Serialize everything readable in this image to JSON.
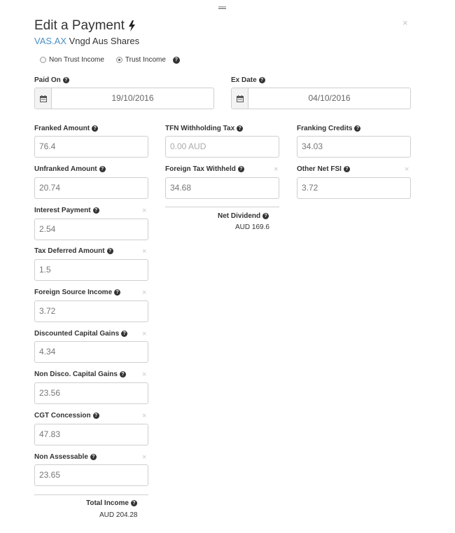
{
  "header": {
    "title": "Edit a Payment",
    "ticker": "VAS.AX",
    "security_name": "Vngd Aus Shares",
    "close": "×"
  },
  "income_type": {
    "options": [
      "Non Trust Income",
      "Trust Income"
    ],
    "selected": "Trust Income"
  },
  "dates": {
    "paid_on_label": "Paid On",
    "paid_on": "19/10/2016",
    "ex_date_label": "Ex Date",
    "ex_date": "04/10/2016"
  },
  "fields": {
    "franked_amount": {
      "label": "Franked Amount",
      "value": "76.4"
    },
    "tfn_withholding": {
      "label": "TFN Withholding Tax",
      "placeholder": "0.00 AUD"
    },
    "franking_credits": {
      "label": "Franking Credits",
      "value": "34.03"
    },
    "unfranked_amount": {
      "label": "Unfranked Amount",
      "value": "20.74"
    },
    "foreign_tax_withheld": {
      "label": "Foreign Tax Withheld",
      "value": "34.68"
    },
    "other_net_fsi": {
      "label": "Other Net FSI",
      "value": "3.72"
    },
    "interest_payment": {
      "label": "Interest Payment",
      "value": "2.54"
    },
    "tax_deferred": {
      "label": "Tax Deferred Amount",
      "value": "1.5"
    },
    "foreign_source_income": {
      "label": "Foreign Source Income",
      "value": "3.72"
    },
    "discounted_capital_gains": {
      "label": "Discounted Capital Gains",
      "value": "4.34"
    },
    "non_disco_capital_gains": {
      "label": "Non Disco. Capital Gains",
      "value": "23.56"
    },
    "cgt_concession": {
      "label": "CGT Concession",
      "value": "47.83"
    },
    "non_assessable": {
      "label": "Non Assessable",
      "value": "23.65"
    }
  },
  "summary": {
    "net_dividend_label": "Net Dividend",
    "net_dividend": "AUD 169.6",
    "total_income_label": "Total Income",
    "total_income": "AUD 204.28"
  },
  "remove_glyph": "×",
  "help_glyph": "?",
  "icons": {
    "title": "lightning-bolt-icon",
    "date": "calendar-icon",
    "help": "question-circle-icon",
    "remove": "close-icon"
  }
}
